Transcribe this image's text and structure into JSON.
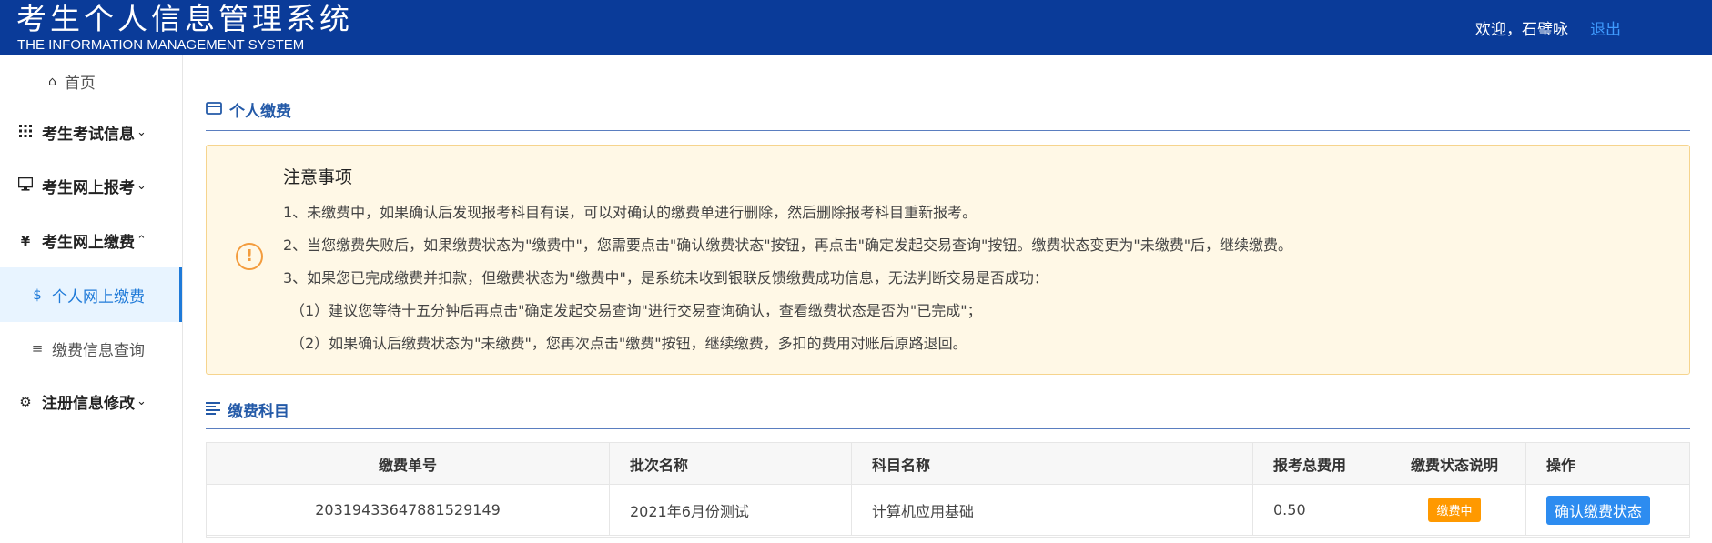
{
  "header": {
    "title_cn": "考生个人信息管理系统",
    "title_en": "THE INFORMATION MANAGEMENT SYSTEM",
    "welcome": "欢迎，石璧咏",
    "logout": "退出"
  },
  "sidebar": {
    "home": "首页",
    "groups": [
      {
        "label": "考生考试信息",
        "icon": "grid-icon"
      },
      {
        "label": "考生网上报考",
        "icon": "monitor-icon"
      },
      {
        "label": "考生网上缴费",
        "icon": "yen-icon"
      },
      {
        "label": "注册信息修改",
        "icon": "gear-icon"
      }
    ],
    "subitems": [
      {
        "label": "个人网上缴费",
        "icon": "dollar-icon",
        "active": true
      },
      {
        "label": "缴费信息查询",
        "icon": "list-icon",
        "active": false
      }
    ]
  },
  "main": {
    "section1_title": "个人缴费",
    "notice": {
      "title": "注意事项",
      "lines": [
        "1、未缴费中，如果确认后发现报考科目有误，可以对确认的缴费单进行删除，然后删除报考科目重新报考。",
        "2、当您缴费失败后，如果缴费状态为\"缴费中\"，您需要点击\"确认缴费状态\"按钮，再点击\"确定发起交易查询\"按钮。缴费状态变更为\"未缴费\"后，继续缴费。",
        "3、如果您已完成缴费并扣款，但缴费状态为\"缴费中\"，是系统未收到银联反馈缴费成功信息，无法判断交易是否成功：",
        "（1）建议您等待十五分钟后再点击\"确定发起交易查询\"进行交易查询确认，查看缴费状态是否为\"已完成\"；",
        "（2）如果确认后缴费状态为\"未缴费\"，您再次点击\"缴费\"按钮，继续缴费，多扣的费用对账后原路退回。"
      ]
    },
    "section2_title": "缴费科目",
    "table": {
      "headers": [
        "缴费单号",
        "批次名称",
        "科目名称",
        "报考总费用",
        "缴费状态说明",
        "操作"
      ],
      "rows": [
        {
          "order_no": "20319433647881529149",
          "batch": "2021年6月份测试",
          "subject": "计算机应用基础",
          "fee": "0.50",
          "status": "缴费中",
          "action": "确认缴费状态"
        }
      ]
    }
  },
  "colors": {
    "header_bg": "#0a3b99",
    "accent": "#1f7ad8",
    "status_badge": "#ff9900",
    "action_button": "#2d8cf0",
    "notice_bg": "#fff8e6"
  }
}
